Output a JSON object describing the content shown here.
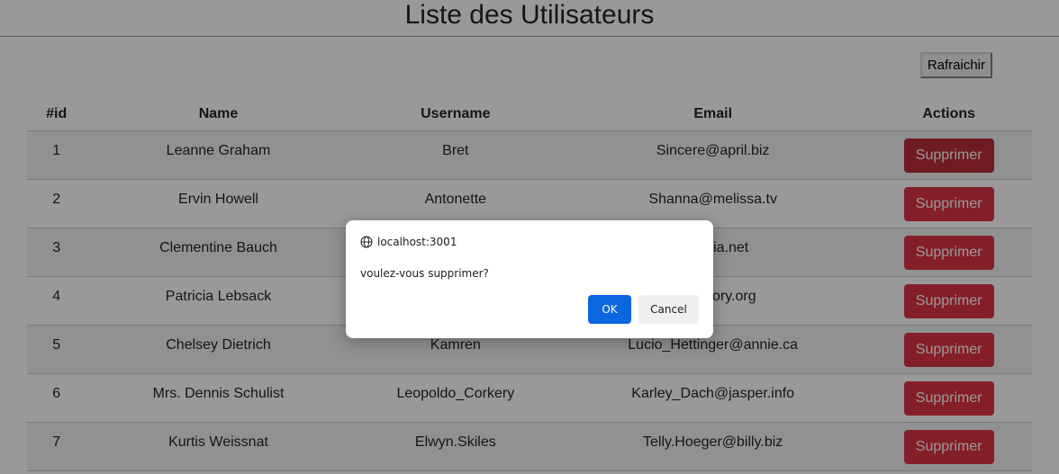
{
  "page": {
    "title": "Liste des Utilisateurs",
    "refresh_label": "Rafraichir"
  },
  "table": {
    "headers": {
      "id": "#id",
      "name": "Name",
      "username": "Username",
      "email": "Email",
      "actions": "Actions"
    },
    "delete_label": "Supprimer",
    "rows": [
      {
        "id": "1",
        "name": "Leanne Graham",
        "username": "Bret",
        "email": "Sincere@april.biz"
      },
      {
        "id": "2",
        "name": "Ervin Howell",
        "username": "Antonette",
        "email": "Shanna@melissa.tv"
      },
      {
        "id": "3",
        "name": "Clementine Bauch",
        "username": "",
        "email": "resenia.net"
      },
      {
        "id": "4",
        "name": "Patricia Lebsack",
        "username": "",
        "email": "ner@kory.org"
      },
      {
        "id": "5",
        "name": "Chelsey Dietrich",
        "username": "Kamren",
        "email": "Lucio_Hettinger@annie.ca"
      },
      {
        "id": "6",
        "name": "Mrs. Dennis Schulist",
        "username": "Leopoldo_Corkery",
        "email": "Karley_Dach@jasper.info"
      },
      {
        "id": "7",
        "name": "Kurtis Weissnat",
        "username": "Elwyn.Skiles",
        "email": "Telly.Hoeger@billy.biz"
      }
    ]
  },
  "dialog": {
    "origin": "localhost:3001",
    "origin_icon": "globe-icon",
    "message": "voulez-vous supprimer?",
    "ok_label": "OK",
    "cancel_label": "Cancel"
  },
  "colors": {
    "danger": "#dc3545",
    "danger_active": "#bb2d3b",
    "ok_blue": "#0b66df"
  }
}
